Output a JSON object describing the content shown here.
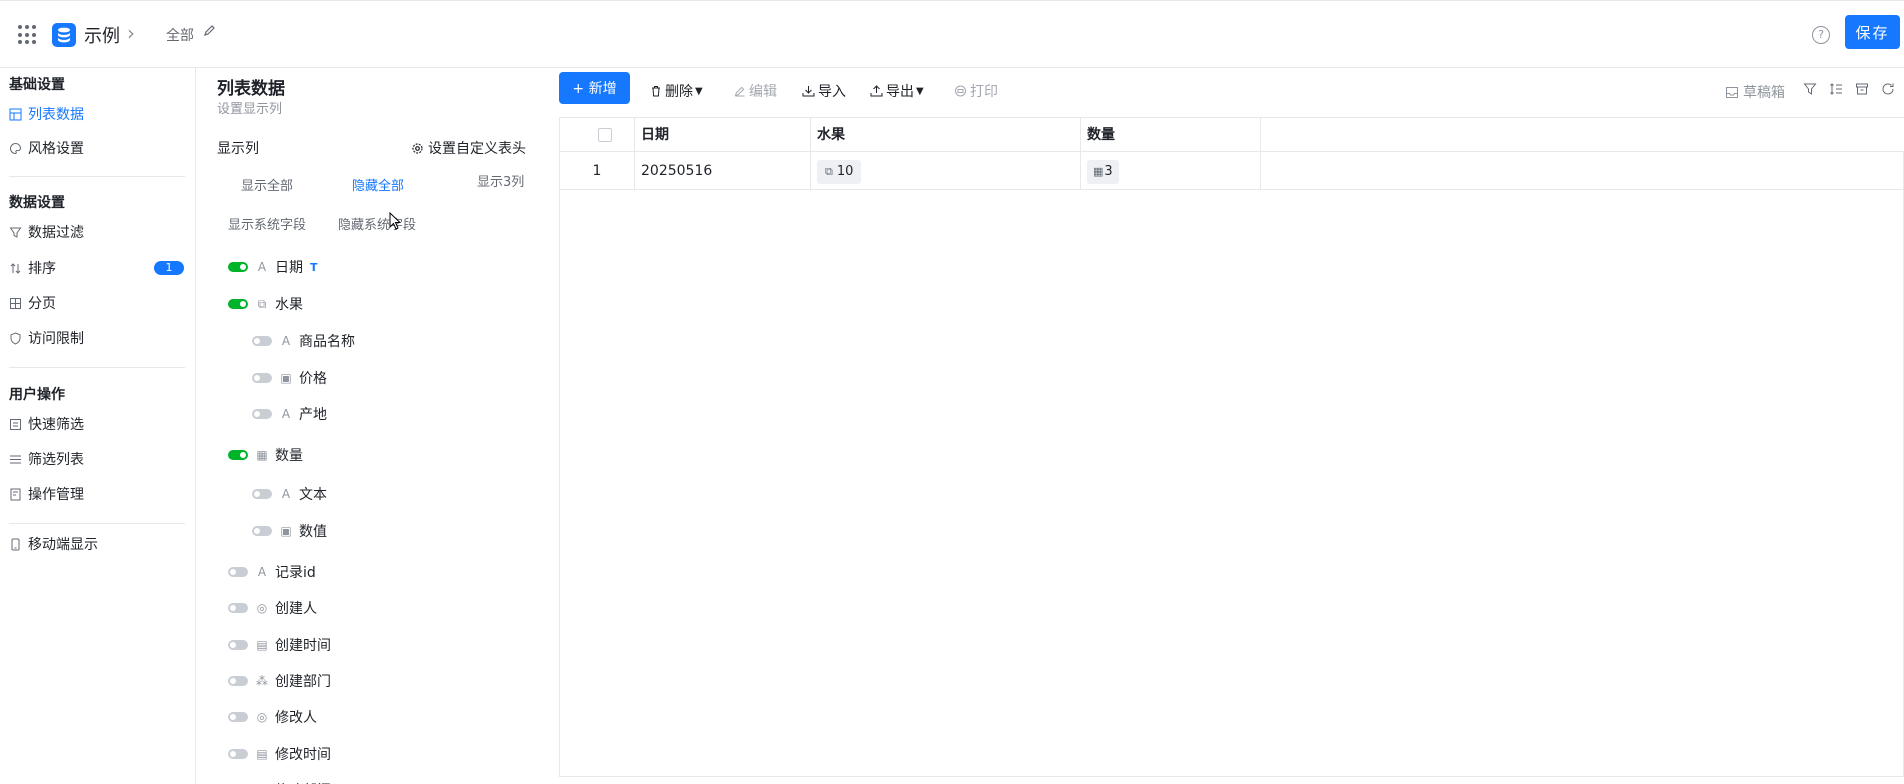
{
  "header": {
    "app_title": "示例",
    "crumb": "全部",
    "save_label": "保存"
  },
  "leftnav": {
    "groups": [
      {
        "title": "基础设置",
        "items": [
          {
            "label": "列表数据",
            "active": true
          },
          {
            "label": "风格设置"
          }
        ]
      },
      {
        "title": "数据设置",
        "items": [
          {
            "label": "数据过滤"
          },
          {
            "label": "排序",
            "badge": "1"
          },
          {
            "label": "分页"
          },
          {
            "label": "访问限制"
          }
        ]
      },
      {
        "title": "用户操作",
        "items": [
          {
            "label": "快速筛选"
          },
          {
            "label": "筛选列表"
          },
          {
            "label": "操作管理"
          }
        ]
      },
      {
        "title": "",
        "items": [
          {
            "label": "移动端显示"
          }
        ]
      }
    ]
  },
  "panel": {
    "title": "列表数据",
    "subtitle": "设置显示列",
    "show_columns": "显示列",
    "custom_header": "设置自定义表头",
    "show_all": "显示全部",
    "hide_all": "隐藏全部",
    "show_count": "显示3列",
    "show_system": "显示系统字段",
    "hide_system": "隐藏系统字段",
    "fields": [
      {
        "label": "日期",
        "type": "A",
        "on": true,
        "indent": 0,
        "tag": "T"
      },
      {
        "label": "水果",
        "type": "⧉",
        "on": true,
        "indent": 0
      },
      {
        "label": "商品名称",
        "type": "A",
        "on": false,
        "indent": 1
      },
      {
        "label": "价格",
        "type": "▣",
        "on": false,
        "indent": 1
      },
      {
        "label": "产地",
        "type": "A",
        "on": false,
        "indent": 1
      },
      {
        "label": "数量",
        "type": "▦",
        "on": true,
        "indent": 0
      },
      {
        "label": "文本",
        "type": "A",
        "on": false,
        "indent": 1
      },
      {
        "label": "数值",
        "type": "▣",
        "on": false,
        "indent": 1
      },
      {
        "label": "记录id",
        "type": "A",
        "on": false,
        "indent": 0
      },
      {
        "label": "创建人",
        "type": "◎",
        "on": false,
        "indent": 0
      },
      {
        "label": "创建时间",
        "type": "▤",
        "on": false,
        "indent": 0
      },
      {
        "label": "创建部门",
        "type": "⁂",
        "on": false,
        "indent": 0
      },
      {
        "label": "修改人",
        "type": "◎",
        "on": false,
        "indent": 0
      },
      {
        "label": "修改时间",
        "type": "▤",
        "on": false,
        "indent": 0
      },
      {
        "label": "修改部门",
        "type": "⁂",
        "on": false,
        "indent": 0
      }
    ]
  },
  "toolbar": {
    "add": "+ 新增",
    "delete": "删除",
    "edit": "编辑",
    "import": "导入",
    "export": "导出",
    "print": "打印",
    "draft": "草稿箱"
  },
  "table": {
    "columns": [
      "日期",
      "水果",
      "数量"
    ],
    "rows": [
      {
        "index": "1",
        "date": "20250516",
        "fruit": "10",
        "qty": "3"
      }
    ]
  },
  "colors": {
    "accent": "#1677ff",
    "toggle_on": "#00b42a"
  }
}
